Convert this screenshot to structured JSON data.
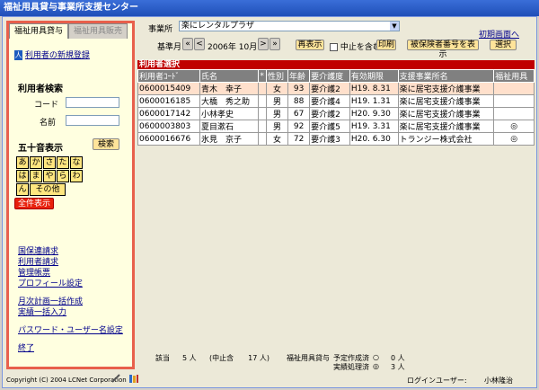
{
  "window": {
    "title": "福祉用具貸与事業所支援センター"
  },
  "sidebar": {
    "tab_active": "福祉用具貸与",
    "tab_inactive": "福祉用具販売",
    "new_register": "利用者の新規登録",
    "search_heading": "利用者検索",
    "code_label": "コード",
    "name_label": "名前",
    "kana_heading": "五十音表示",
    "search_button": "検索",
    "kana_rows": [
      [
        "あ",
        "か",
        "さ",
        "た",
        "な"
      ],
      [
        "は",
        "ま",
        "や",
        "ら",
        "わ"
      ],
      [
        "ん",
        "その他"
      ]
    ],
    "all_display_button": "全件表示",
    "links": [
      "国保連請求",
      "利用者請求",
      "管理帳票",
      "プロフィール設定",
      "月次計画一括作成",
      "実績一括入力",
      "パスワード・ユーザー名設定",
      "終了"
    ]
  },
  "header": {
    "office_label": "事業所",
    "office_value": "楽にレンタルプラザ",
    "home_link": "初期画面へ",
    "base_month_label": "基準月",
    "base_month_value": "2006年 10月",
    "redisplay_button": "再表示",
    "include_suspended": "中止を含む",
    "print_button": "印刷",
    "show_insured_button": "被保険者番号を表示",
    "select_button": "選択"
  },
  "grid": {
    "title": "利用者選択",
    "headers": [
      "利用者ｺｰﾄﾞ",
      "氏名",
      "*",
      "性別",
      "年齢",
      "要介護度",
      "有効期限",
      "支援事業所名",
      "福祉用具"
    ],
    "rows": [
      [
        "0600015409",
        "青木　幸子",
        "",
        "女",
        "93",
        "要介護2",
        "H19. 8.31",
        "楽に居宅支援介護事業",
        ""
      ],
      [
        "0600016185",
        "大橋　秀之助",
        "",
        "男",
        "88",
        "要介護4",
        "H19. 1.31",
        "楽に居宅支援介護事業",
        ""
      ],
      [
        "0600017142",
        "小林孝史",
        "",
        "男",
        "67",
        "要介護2",
        "H20. 9.30",
        "楽に居宅支援介護事業",
        ""
      ],
      [
        "0600003803",
        "夏目漱石",
        "",
        "男",
        "92",
        "要介護5",
        "H19. 3.31",
        "楽に居宅支援介護事業",
        "◎"
      ],
      [
        "0600016676",
        "氷見　京子",
        "",
        "女",
        "72",
        "要介護3",
        "H20. 6.30",
        "トランジー株式会社",
        "◎"
      ]
    ]
  },
  "summary": {
    "count_label": "該当",
    "count_value": "5 人",
    "suspended_text": "(中止含　　17 人)",
    "rental_label": "福祉用具貸与",
    "planned_label": "予定作成済",
    "planned_mark": "○",
    "planned_value": "0 人",
    "done_label": "実績処理済",
    "done_mark": "◎",
    "done_value": "3 人"
  },
  "status": {
    "copyright": "Copyright (C) 2004 LCNet Corporation",
    "login_label": "ログインユーザー:",
    "login_user": "小林隆治"
  }
}
